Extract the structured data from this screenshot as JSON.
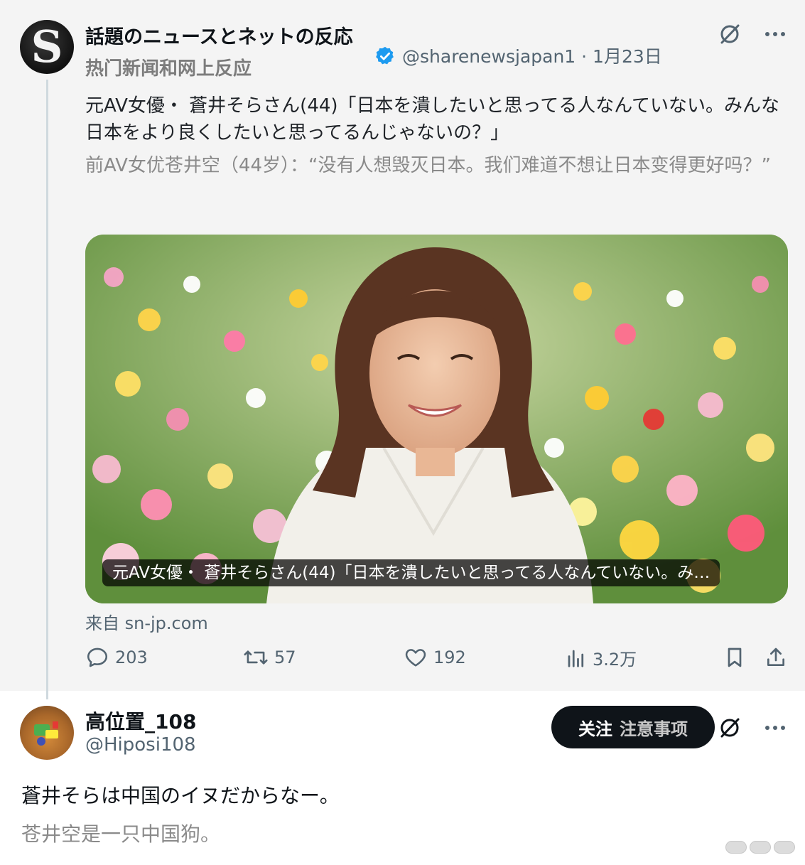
{
  "quoted_post": {
    "author": {
      "name": "話題のニュースとネットの反応",
      "name_translation": "热门新闻和网上反应",
      "handle_date": "@sharenewsjapan1 · 1月23日",
      "avatar_letter": "S"
    },
    "text": "元AV女優・ 蒼井そらさん(44)「日本を潰したいと思ってる人なんていない。みんな日本をより良くしたいと思ってるんじゃないの？」",
    "text_translation": "前AV女优苍井空（44岁）：“没有人想毁灭日本。我们难道不想让日本变得更好吗？”",
    "media": {
      "caption": "元AV女優・ 蒼井そらさん(44)「日本を潰したいと思ってる人なんていない。み…"
    },
    "source": "来自 sn-jp.com",
    "stats": {
      "replies": "203",
      "reposts": "57",
      "likes": "192",
      "views": "3.2万"
    }
  },
  "reply": {
    "name": "高位置_108",
    "handle": "@Hiposi108",
    "follow_label": "关注",
    "follow_sub_label": "注意事项",
    "text": "蒼井そらは中国のイヌだからなー。",
    "text_translation": "苍井空是一只中国狗。"
  },
  "colors": {
    "verified": "#1d9bf0",
    "text_primary": "#0f1419",
    "text_secondary": "#536471",
    "follow_bg": "#0f1419"
  },
  "icons": [
    "verified-badge-icon",
    "grok-icon",
    "more-icon",
    "reply-icon",
    "repost-icon",
    "like-icon",
    "views-icon",
    "bookmark-icon",
    "share-icon"
  ]
}
